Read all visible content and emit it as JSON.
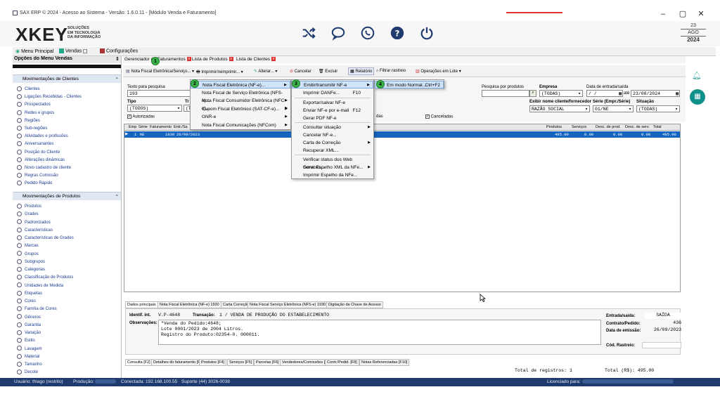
{
  "window": {
    "title": "SAX ERP © 2024 - Acesso ao Sistema - Versão: 1.6.0.11 - [Módulo Venda e Faturamento]",
    "minimize": "–",
    "maximize": "▢",
    "close": "✕"
  },
  "header": {
    "logo_text": "XKEY",
    "logo_sub1": "SOLUÇÕES",
    "logo_sub2": "EM TECNOLOGIA",
    "logo_sub3": "DA INFORMAÇÃO",
    "date_day": "23",
    "date_month": "AGO",
    "date_year": "2024"
  },
  "menustrip": {
    "menu_principal": "Menu Principal",
    "vendas": "Vendas",
    "configuracoes": "Configurações"
  },
  "left": {
    "header": "Opções do Menu Vendas",
    "section1": "Movimentações de Clientes",
    "clients": [
      "Clientes",
      "Ligações Recebidas - Clientes",
      "Prospectados",
      "Redes e grupos",
      "Regiões",
      "Sub-regiões",
      "Atividades e profissões",
      "Aniversariantes",
      "Posição do Cliente",
      "Alterações dinâmicas",
      "Novo cadastro de cliente",
      "Regras Comissão",
      "Pedido Rápido"
    ],
    "section2": "Movimentações de Produtos",
    "products": [
      "Produtos",
      "Grades",
      "Padronizados",
      "Características",
      "Características de Grades",
      "Marcas",
      "Grupos",
      "Subgrupos",
      "Categorias",
      "Classificação de Produtos",
      "Unidades de Medida",
      "Etiquetas",
      "Cores",
      "Família de Cores",
      "Gêneros",
      "Garantia",
      "Variação",
      "Estilo",
      "Lavagem",
      "Material",
      "Tamanho",
      "Decote"
    ]
  },
  "tabs": {
    "t1": "Gerenciador de Faturamentos",
    "t2": "Lista de Produtos",
    "t3": "Lista de Clientes"
  },
  "toolbar": {
    "nfe": "Nota Fiscal Eletrônica/Serviço...",
    "imprimir": "Imprimir/reimprimir...",
    "alterar": "Alterar...",
    "cancelar": "Cancelar",
    "excluir": "Excluir",
    "relatorio": "Relatório",
    "filtrar": "Filtrar rastreio",
    "operacoes": "Operações em Lote"
  },
  "form": {
    "texto_pesquisa_label": "Texto para pesquisa",
    "texto_pesquisa_value": "193",
    "tipo_label": "Tipo",
    "tipo_value": "(TODOS)",
    "tipo2_value": "(T",
    "tr_label": "Tr",
    "autorizadas": "Autorizadas",
    "das": "das",
    "canceladas": "Canceladas",
    "pesquisa_produtos": "Pesquisa por produtos",
    "empresa_label": "Empresa",
    "empresa_value": "(TODAS)",
    "data_label": "Data de entrada/saída",
    "data_de": "/  /",
    "ate": "até",
    "data_ate": "23/08/2024",
    "exibir_label": "Exibir nome cliente/fornecedor",
    "exibir_value": "RAZÃO SOCIAL",
    "serie_label": "Série (Empr./Série)",
    "serie_value": "01/NE",
    "situacao_label": "Situação",
    "situacao_value": "(TODAS)"
  },
  "grid": {
    "headers": [
      "Emp",
      "Série",
      "Faturamento",
      "Entr./Sa"
    ],
    "right_headers": [
      "Produtos",
      "Serviços",
      "Desc. de prod.",
      "Desc. de serv.",
      "Total"
    ],
    "row": {
      "emp": "1",
      "serie": "NE",
      "fat": "1930",
      "data": "26/09/2023",
      "produtos": "495.00",
      "servicos": "0.00",
      "desc_prod": "0.00",
      "desc_serv": "0.00",
      "total": "495.00"
    }
  },
  "menu1": {
    "items": [
      "Nota Fiscal Eletrônica (NF-e)...",
      "Nota Fiscal de Serviço Eletrônica (NFS-e)...",
      "Nota Fiscal Consumidor Eletrônica (NFC-e)...",
      "Cupom Fiscal Eletrônico (SAT-CF-e)...",
      "GNR-e",
      "Nota Fiscal Comunicações (NFCom)"
    ]
  },
  "menu2": {
    "items": [
      "Emitir/transmitir NF-e",
      "Imprimir DANFe...",
      "Exportar/salvar NF-e",
      "Enviar NF-e por e-mail",
      "Gerar PDF NF-e",
      "Consultar situação",
      "Cancelar NF-e...",
      "Carta de Correção",
      "Recuperar XML...",
      "Verificar status dos Web Services...",
      "Gerar Espelho XML da NFe...",
      "Imprimir Espelho da NFe..."
    ],
    "shortcut_danfe": "F10",
    "shortcut_email": "F12"
  },
  "menu3": {
    "item": "Em modo Normal...",
    "shortcut": "Ctrl+F2"
  },
  "badges": [
    "1",
    "2",
    "3",
    "4"
  ],
  "detail_tabs": [
    "Dados principais",
    "Nota Fiscal Eletrônica (NF-e) 1930",
    "Carta Correção",
    "Nota Fiscal Serviço Eletrônica (NFS-e) 1930",
    "Digitação da Chave de Acesso"
  ],
  "detail": {
    "ident_label": "Identif. int.",
    "ident_value": "V.P-4648",
    "transacao_label": "Transação:",
    "transacao_value": "1 / VENDA DE PRODUÇÃO DO ESTABELECIMENTO",
    "obs_label": "Observações:",
    "obs_lines": [
      "\"Venda do Pedido:4648;",
      "Lote 0001/2023 de 2004 Litros.",
      "Registro do Produto:02354-0. 000011."
    ],
    "entrada_label": "Entrada/saída:",
    "entrada_value": "SAÍDA",
    "contrato_label": "Contrato/Pedido:",
    "contrato_value": "436",
    "emissao_label": "Data de emissão:",
    "emissao_value": "26/09/2023",
    "rastreio_label": "Cód. Rastreio:"
  },
  "bottom_tabs": [
    "Consulta [F2]",
    "Detalhes do faturamento [F3]",
    "Produtos [F4]",
    "Serviços [F5]",
    "Parcelas [F6]",
    "Vendedores/Comissões [F7]",
    "Contr./Pedid. [F8]",
    "Notas Referenciadas [F10]"
  ],
  "totals": {
    "registros": "Total de registros: 1",
    "total": "Total (R$): 495.00"
  },
  "status": {
    "usuario": "Usuário: thiago (restrito)",
    "producao": "Produção:",
    "conectada": "Conectada: 192.168.100.55",
    "suporte": "Suporte (44) 3026-0038",
    "licenciado": "Licenciado para:"
  }
}
